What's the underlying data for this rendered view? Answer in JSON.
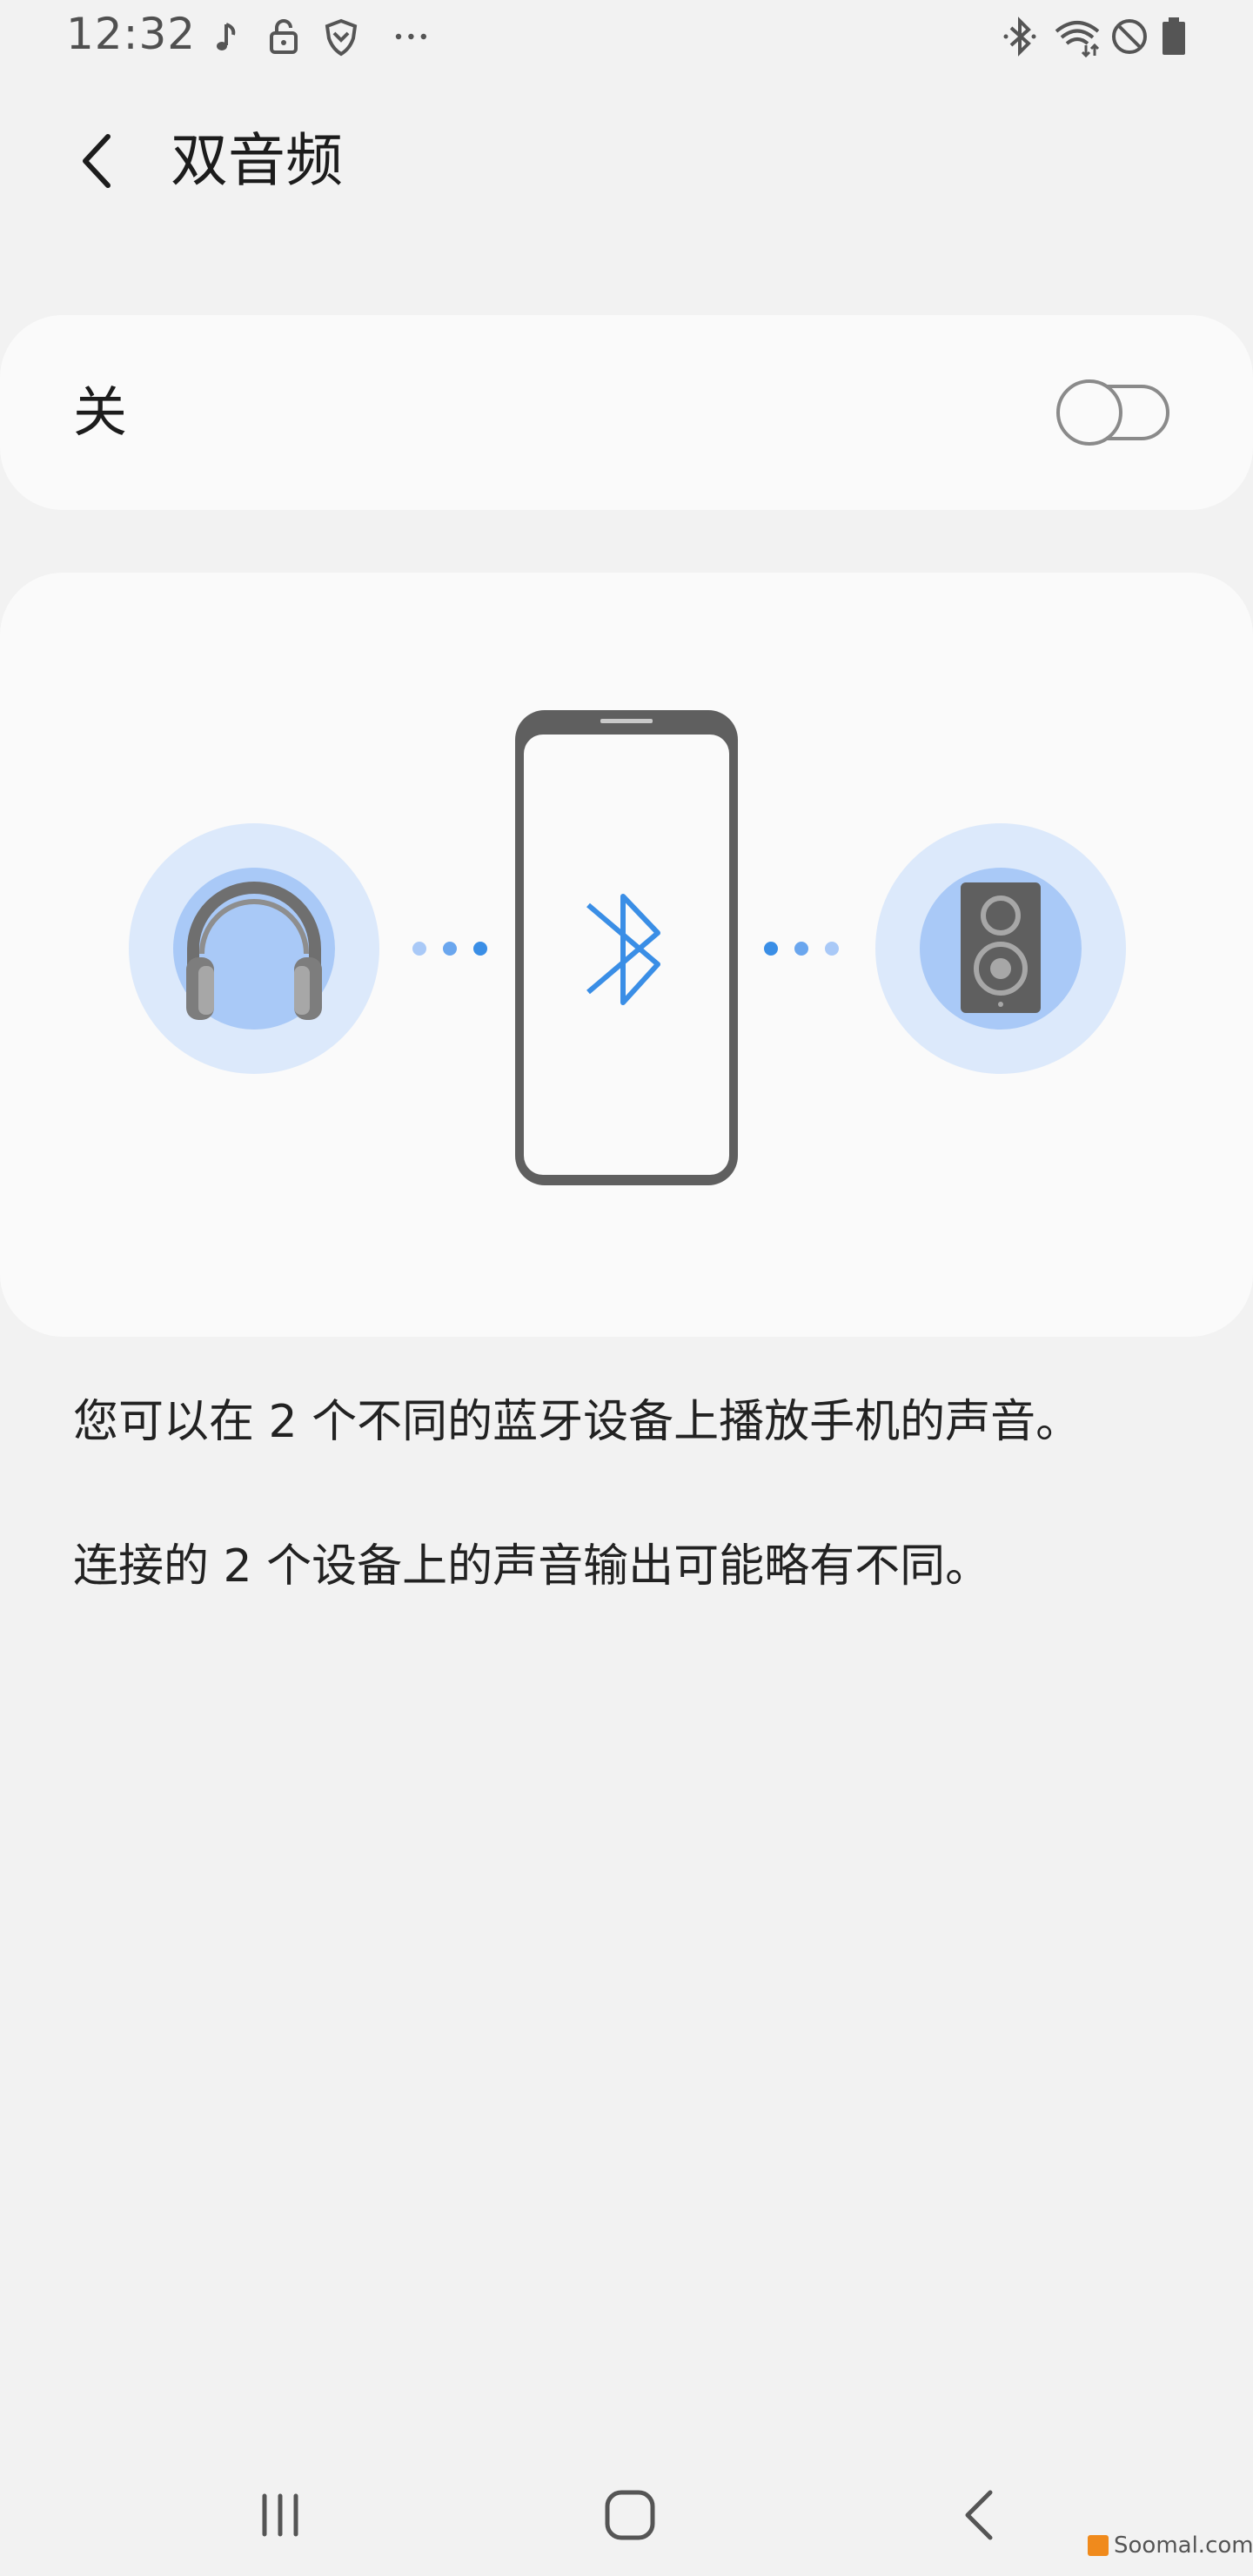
{
  "status_bar": {
    "time": "12:32",
    "left_icons": [
      "music-note-icon",
      "lock-icon",
      "shield-icon",
      "more-dots-icon"
    ],
    "right_icons": [
      "bluetooth-icon",
      "wifi-icon",
      "do-not-disturb-icon",
      "battery-icon"
    ]
  },
  "header": {
    "title": "双音频",
    "back_icon": "chevron-left-icon"
  },
  "toggle": {
    "label": "关",
    "state": "off"
  },
  "illustration": {
    "left_device": "headphones-icon",
    "center_device": "phone-bluetooth-icon",
    "right_device": "speaker-icon",
    "accent_color": "#3a8ee6",
    "bubble_outer_color": "#dce9fb",
    "bubble_inner_color": "#a9c9f7"
  },
  "description": {
    "line1": "您可以在 2 个不同的蓝牙设备上播放手机的声音。",
    "line2": "连接的 2 个设备上的声音输出可能略有不同。"
  },
  "nav_bar": {
    "items": [
      "recents-icon",
      "home-icon",
      "back-icon"
    ]
  },
  "watermark": {
    "text": "Soomal.com"
  }
}
